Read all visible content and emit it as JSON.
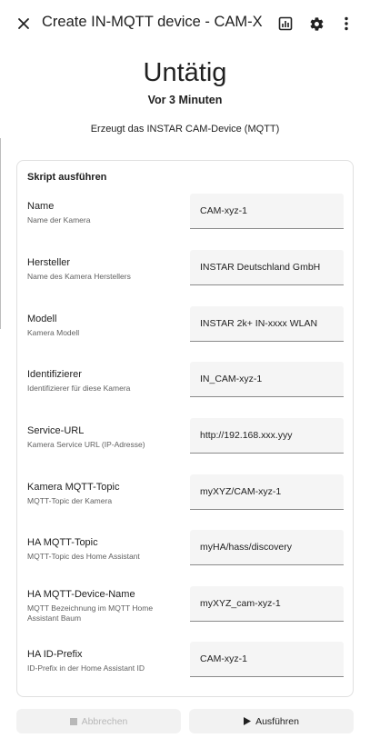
{
  "header": {
    "title": "Create IN-MQTT device - CAM-X",
    "icons": [
      "close-icon",
      "chart-icon",
      "gear-icon",
      "more-vert-icon"
    ]
  },
  "status": {
    "title": "Untätig",
    "subtitle": "Vor 3 Minuten",
    "description": "Erzeugt das INSTAR CAM-Device (MQTT)"
  },
  "card": {
    "title": "Skript ausführen",
    "fields": [
      {
        "label": "Name",
        "hint": "Name der Kamera",
        "value": "CAM-xyz-1"
      },
      {
        "label": "Hersteller",
        "hint": "Name des Kamera Herstellers",
        "value": "INSTAR Deutschland GmbH"
      },
      {
        "label": "Modell",
        "hint": "Kamera Modell",
        "value": "INSTAR 2k+ IN-xxxx WLAN"
      },
      {
        "label": "Identifizierer",
        "hint": "Identifizierer für diese Kamera",
        "value": "IN_CAM-xyz-1"
      },
      {
        "label": "Service-URL",
        "hint": "Kamera Service URL (IP-Adresse)",
        "value": "http://192.168.xxx.yyy"
      },
      {
        "label": "Kamera MQTT-Topic",
        "hint": "MQTT-Topic der Kamera",
        "value": "myXYZ/CAM-xyz-1"
      },
      {
        "label": "HA MQTT-Topic",
        "hint": "MQTT-Topic des Home Assistant",
        "value": "myHA/hass/discovery"
      },
      {
        "label": "HA MQTT-Device-Name",
        "hint": "MQTT Bezeichnung im MQTT Home Assistant Baum",
        "value": "myXYZ_cam-xyz-1"
      },
      {
        "label": "HA ID-Prefix",
        "hint": "ID-Prefix in der Home Assistant ID",
        "value": "CAM-xyz-1"
      }
    ]
  },
  "actions": {
    "cancel_label": "Abbrechen",
    "cancel_icon": "stop-icon",
    "run_label": "Ausführen",
    "run_icon": "play-icon"
  },
  "colors": {
    "text": "#212121",
    "field_bg": "#f5f5f5",
    "disabled_text": "#b8b8b8"
  }
}
